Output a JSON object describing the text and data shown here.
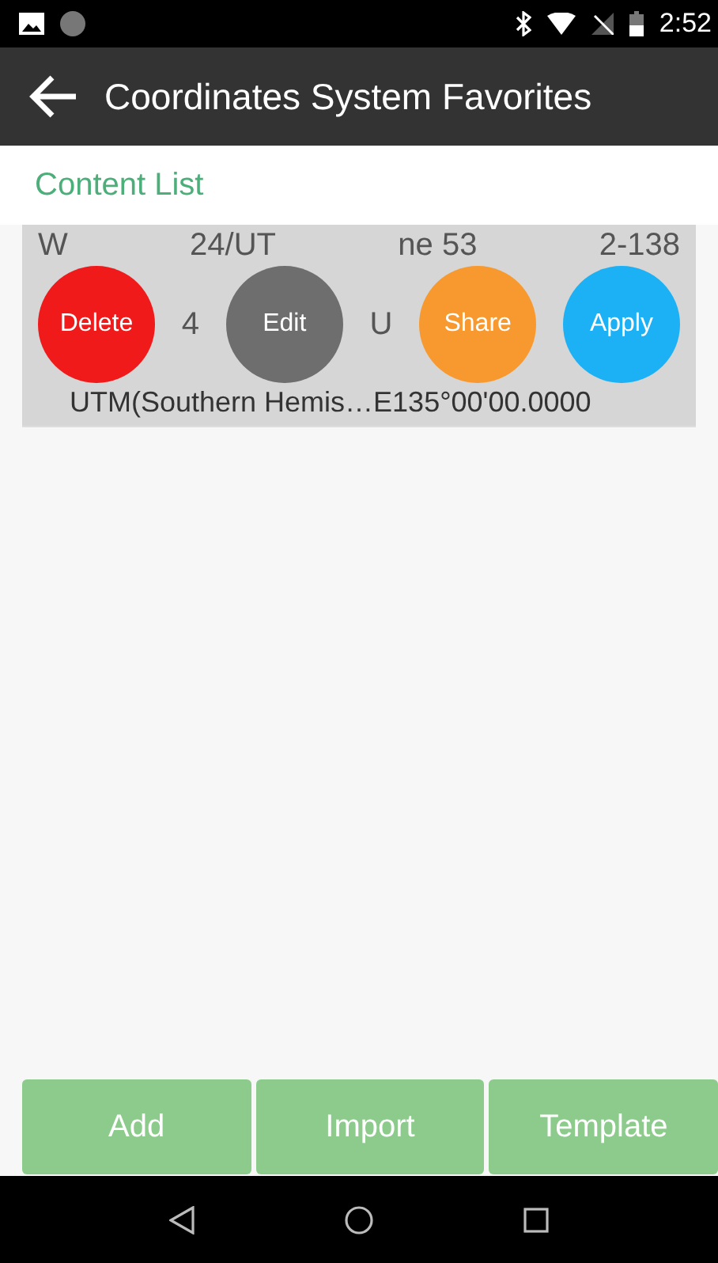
{
  "status_bar": {
    "time": "2:52"
  },
  "app_bar": {
    "title": "Coordinates System Favorites"
  },
  "section_title": "Content List",
  "list_item": {
    "selected": true,
    "line_1_fragments": [
      "W",
      "24/UT",
      "ne 53",
      "2-138"
    ],
    "line_2_fragments": [
      "4",
      "U"
    ],
    "line_3": "UTM(Southern Hemis…E135°00'00.0000"
  },
  "actions": [
    {
      "label": "Delete",
      "color": "#f01a1a"
    },
    {
      "label": "Edit",
      "color": "#6e6e6e"
    },
    {
      "label": "Share",
      "color": "#f7992f"
    },
    {
      "label": "Apply",
      "color": "#1cb0f5"
    }
  ],
  "buttons": [
    "Add",
    "Import",
    "Template"
  ]
}
